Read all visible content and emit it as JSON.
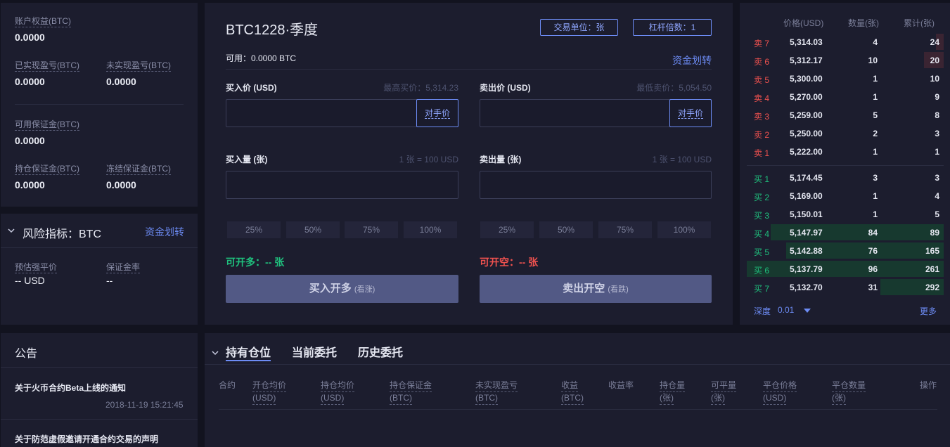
{
  "account": {
    "equity_label": "账户权益(BTC)",
    "equity_value": "0.0000",
    "realized_label": "已实现盈亏(BTC)",
    "realized_value": "0.0000",
    "unrealized_label": "未实现盈亏(BTC)",
    "unrealized_value": "0.0000",
    "available_margin_label": "可用保证金(BTC)",
    "available_margin_value": "0.0000",
    "position_margin_label": "持仓保证金(BTC)",
    "position_margin_value": "0.0000",
    "frozen_margin_label": "冻结保证金(BTC)",
    "frozen_margin_value": "0.0000"
  },
  "risk": {
    "title": "风险指标：BTC",
    "transfer_link": "资金划转",
    "liq_price_label": "预估强平价",
    "liq_price_value": "-- USD",
    "margin_rate_label": "保证金率",
    "margin_rate_value": "--"
  },
  "notice": {
    "title": "公告",
    "items": [
      {
        "title": "关于火币合约Beta上线的通知",
        "time": "2018-11-19 15:21:45"
      },
      {
        "title": "关于防范虚假邀请开通合约交易的声明"
      }
    ]
  },
  "trade": {
    "contract_title": "BTC1228·季度",
    "unit_badge": "交易单位：张",
    "leverage_badge": "杠杆倍数：1",
    "available": "可用：0.0000 BTC",
    "transfer_link": "资金划转",
    "buy_price_label": "买入价 (USD)",
    "buy_price_hint": "最高买价：5,314.23",
    "sell_price_label": "卖出价 (USD)",
    "sell_price_hint": "最低卖价：5,054.50",
    "opp_price": "对手价",
    "buy_qty_label": "买入量 (张)",
    "sell_qty_label": "卖出量 (张)",
    "qty_hint": "1 张 = 100 USD",
    "percents": [
      "25%",
      "50%",
      "75%",
      "100%"
    ],
    "can_long": "可开多：-- 张",
    "can_short": "可开空：-- 张",
    "buy_button": "买入开多",
    "buy_button_sub": "(看涨)",
    "sell_button": "卖出开空",
    "sell_button_sub": "(看跌)"
  },
  "orderbook": {
    "headers": [
      "价格(USD)",
      "数量(张)",
      "累计(张)"
    ],
    "asks": [
      {
        "label": "卖 7",
        "price": "5,314.03",
        "qty": "4",
        "total": "24",
        "depth": 0.04
      },
      {
        "label": "卖 6",
        "price": "5,312.17",
        "qty": "10",
        "total": "20",
        "depth": 0.1
      },
      {
        "label": "卖 5",
        "price": "5,300.00",
        "qty": "1",
        "total": "10",
        "depth": 0
      },
      {
        "label": "卖 4",
        "price": "5,270.00",
        "qty": "1",
        "total": "9",
        "depth": 0
      },
      {
        "label": "卖 3",
        "price": "5,259.00",
        "qty": "5",
        "total": "8",
        "depth": 0
      },
      {
        "label": "卖 2",
        "price": "5,250.00",
        "qty": "2",
        "total": "3",
        "depth": 0
      },
      {
        "label": "卖 1",
        "price": "5,222.00",
        "qty": "1",
        "total": "1",
        "depth": 0
      }
    ],
    "bids": [
      {
        "label": "买 1",
        "price": "5,174.45",
        "qty": "3",
        "total": "3",
        "depth": 0
      },
      {
        "label": "买 2",
        "price": "5,169.00",
        "qty": "1",
        "total": "4",
        "depth": 0
      },
      {
        "label": "买 3",
        "price": "5,150.01",
        "qty": "1",
        "total": "5",
        "depth": 0
      },
      {
        "label": "买 4",
        "price": "5,147.97",
        "qty": "84",
        "total": "89",
        "depth": 0.88
      },
      {
        "label": "买 5",
        "price": "5,142.88",
        "qty": "76",
        "total": "165",
        "depth": 0.8
      },
      {
        "label": "买 6",
        "price": "5,137.79",
        "qty": "96",
        "total": "261",
        "depth": 1.0
      },
      {
        "label": "买 7",
        "price": "5,132.70",
        "qty": "31",
        "total": "292",
        "depth": 0.32
      }
    ],
    "depth_label": "深度",
    "depth_value": "0.01",
    "more_link": "更多"
  },
  "positions": {
    "tabs": [
      "持有仓位",
      "当前委托",
      "历史委托"
    ],
    "columns": [
      {
        "name": "合约",
        "unit": ""
      },
      {
        "name": "开仓均价",
        "unit": "(USD)"
      },
      {
        "name": "持仓均价",
        "unit": "(USD)"
      },
      {
        "name": "持仓保证金",
        "unit": "(BTC)"
      },
      {
        "name": "未实现盈亏",
        "unit": "(BTC)"
      },
      {
        "name": "收益",
        "unit": "(BTC)"
      },
      {
        "name": "收益率",
        "unit": ""
      },
      {
        "name": "持仓量",
        "unit": "(张)"
      },
      {
        "name": "可平量",
        "unit": "(张)"
      },
      {
        "name": "平仓价格",
        "unit": "(USD)"
      },
      {
        "name": "平仓数量",
        "unit": "(张)"
      },
      {
        "name": "操作",
        "unit": ""
      }
    ]
  },
  "colors": {
    "accent": "#6d8cf5",
    "buy": "#1fc07d",
    "sell": "#f0524f",
    "panel": "#1c1d2e"
  }
}
